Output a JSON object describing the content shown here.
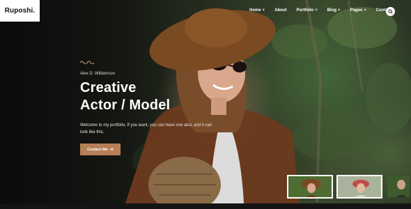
{
  "brand": {
    "logo": "Ruposhi."
  },
  "nav": {
    "items": [
      {
        "label": "Home",
        "has_dropdown": true
      },
      {
        "label": "About",
        "has_dropdown": false
      },
      {
        "label": "Portfolio",
        "has_dropdown": true
      },
      {
        "label": "Blog",
        "has_dropdown": true
      },
      {
        "label": "Pages",
        "has_dropdown": true
      },
      {
        "label": "Contact",
        "has_dropdown": false
      }
    ],
    "dropdown_glyph": "+",
    "search_icon": "search-icon"
  },
  "hero": {
    "subtitle": "Alex D. Williamson",
    "title_line1": "Creative",
    "title_line2": "Actor / Model",
    "description": "Welcome to my portfolio, If you want, you can have one also, and it can look like this.",
    "cta_label": "Contact Me",
    "cta_icon": "arrow-right-icon"
  },
  "colors": {
    "accent": "#b77f58",
    "text": "#ffffff"
  }
}
